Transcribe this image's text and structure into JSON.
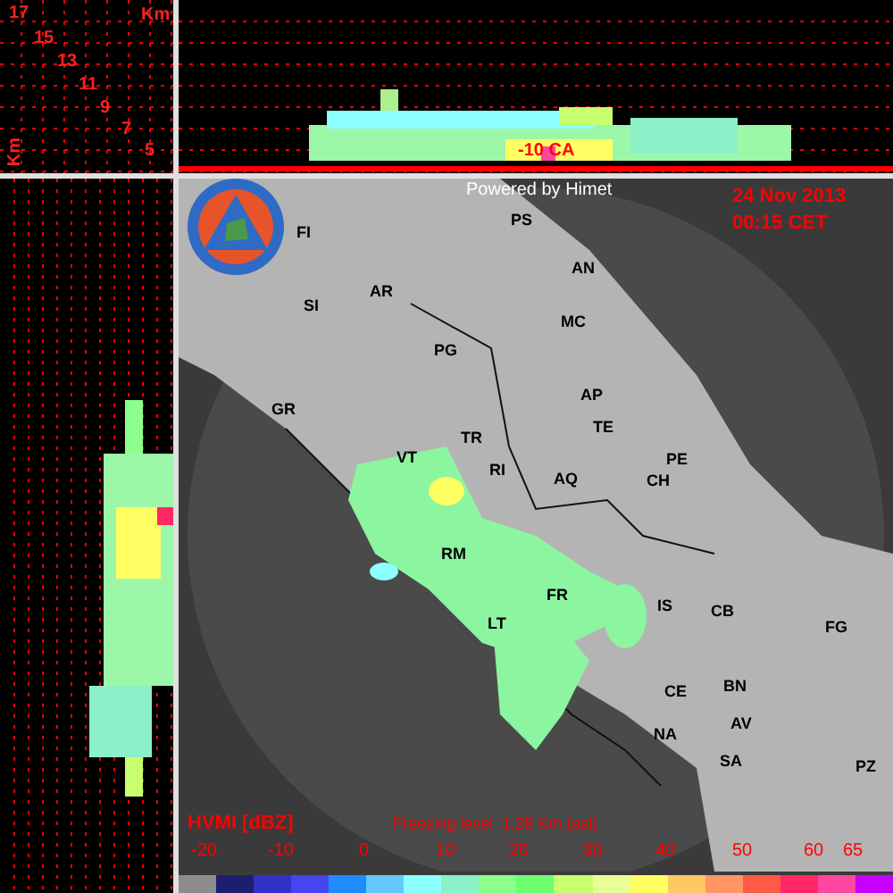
{
  "vertical_profile": {
    "unit_label": "Km",
    "axis_label": "Km",
    "height_labels": [
      "17",
      "15",
      "13",
      "11",
      "9",
      "7",
      "5"
    ]
  },
  "cross_section": {
    "marker_label": "-10 CA"
  },
  "map": {
    "credit": "Powered by Himet",
    "date": "24 Nov 2013",
    "time": "00:15 CET",
    "cities": [
      {
        "label": "FI"
      },
      {
        "label": "PS"
      },
      {
        "label": "AN"
      },
      {
        "label": "AR"
      },
      {
        "label": "SI"
      },
      {
        "label": "MC"
      },
      {
        "label": "PG"
      },
      {
        "label": "GR"
      },
      {
        "label": "AP"
      },
      {
        "label": "TE"
      },
      {
        "label": "TR"
      },
      {
        "label": "VT"
      },
      {
        "label": "PE"
      },
      {
        "label": "RI"
      },
      {
        "label": "AQ"
      },
      {
        "label": "CH"
      },
      {
        "label": "RM"
      },
      {
        "label": "FR"
      },
      {
        "label": "IS"
      },
      {
        "label": "CB"
      },
      {
        "label": "FG"
      },
      {
        "label": "LT"
      },
      {
        "label": "CE"
      },
      {
        "label": "BN"
      },
      {
        "label": "AV"
      },
      {
        "label": "NA"
      },
      {
        "label": "SA"
      },
      {
        "label": "PZ"
      }
    ]
  },
  "legend": {
    "title": "HVMI [dBZ]",
    "freezing_level": "Freezing level  1.28 Km (asl)",
    "ticks": [
      "-20",
      "-10",
      "0",
      "10",
      "20",
      "30",
      "40",
      "50",
      "60",
      "65"
    ],
    "swatches": [
      {
        "color": "#8c8c8c"
      },
      {
        "color": "#1e1e6e"
      },
      {
        "color": "#3232c8"
      },
      {
        "color": "#4646f0"
      },
      {
        "color": "#1e8cff"
      },
      {
        "color": "#64c8ff"
      },
      {
        "color": "#8cffff"
      },
      {
        "color": "#8cf0c8"
      },
      {
        "color": "#8cff8c"
      },
      {
        "color": "#6eff6e"
      },
      {
        "color": "#c8ff6e"
      },
      {
        "color": "#e6ff96"
      },
      {
        "color": "#ffff64"
      },
      {
        "color": "#ffc864"
      },
      {
        "color": "#ff9664"
      },
      {
        "color": "#ff5a46"
      },
      {
        "color": "#ff2864"
      },
      {
        "color": "#ff46a0"
      },
      {
        "color": "#c800ff"
      }
    ]
  }
}
